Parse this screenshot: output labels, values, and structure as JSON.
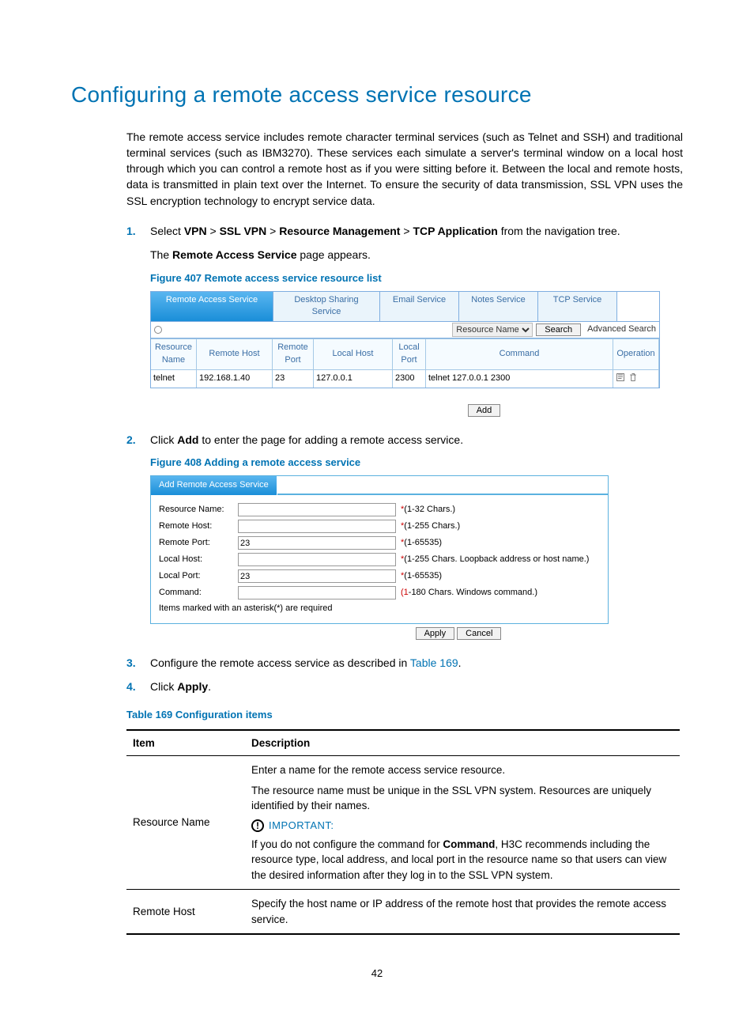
{
  "title": "Configuring a remote access service resource",
  "intro": "The remote access service includes remote character terminal services (such as Telnet and SSH) and traditional terminal services (such as IBM3270). These services each simulate a server's terminal window on a local host through which you can control a remote host as if you were sitting before it. Between the local and remote hosts, data is transmitted in plain text over the Internet. To ensure the security of data transmission, SSL VPN uses the SSL encryption technology to encrypt service data.",
  "step1_pre": "Select",
  "step1_nav": [
    "VPN",
    "SSL VPN",
    "Resource Management",
    "TCP Application"
  ],
  "step1_post": "from the navigation tree.",
  "step1_sub_pre": "The",
  "step1_sub_bold": "Remote Access Service",
  "step1_sub_post": "page appears.",
  "fig407_caption": "Figure 407 Remote access service resource list",
  "fig407": {
    "tabs": [
      "Remote Access Service",
      "Desktop Sharing Service",
      "Email Service",
      "Notes Service",
      "TCP Service"
    ],
    "search_select": "Resource Name",
    "search_button": "Search",
    "advanced": "Advanced Search",
    "headers": [
      "Resource Name",
      "Remote Host",
      "Remote Port",
      "Local Host",
      "Local Port",
      "Command",
      "Operation"
    ],
    "row": {
      "resource_name": "telnet",
      "remote_host": "192.168.1.40",
      "remote_port": "23",
      "local_host": "127.0.0.1",
      "local_port": "2300",
      "command": "telnet 127.0.0.1 2300"
    },
    "add_button": "Add"
  },
  "step2_pre": "Click",
  "step2_bold": "Add",
  "step2_post": "to enter the page for adding a remote access service.",
  "fig408_caption": "Figure 408 Adding a remote access service",
  "fig408": {
    "header": "Add Remote Access Service",
    "rows": [
      {
        "label": "Resource Name:",
        "value": "",
        "hint": "*(1-32 Chars.)"
      },
      {
        "label": "Remote Host:",
        "value": "",
        "hint": "*(1-255 Chars.)"
      },
      {
        "label": "Remote Port:",
        "value": "23",
        "hint": "*(1-65535)"
      },
      {
        "label": "Local Host:",
        "value": "",
        "hint": "*(1-255 Chars. Loopback address or host name.)"
      },
      {
        "label": "Local Port:",
        "value": "23",
        "hint": "*(1-65535)"
      },
      {
        "label": "Command:",
        "value": "",
        "hint": "(1-180 Chars. Windows command.)"
      }
    ],
    "note": "Items marked with an asterisk(*) are required",
    "apply": "Apply",
    "cancel": "Cancel"
  },
  "step3_pre": "Configure the remote access service as described in",
  "step3_link": "Table 169",
  "step3_post": ".",
  "step4_pre": "Click",
  "step4_bold": "Apply",
  "step4_post": ".",
  "t169_caption": "Table 169 Configuration items",
  "t169": {
    "headers": [
      "Item",
      "Description"
    ],
    "row1_item": "Resource Name",
    "row1_desc_p1": "Enter a name for the remote access service resource.",
    "row1_desc_p2": "The resource name must be unique in the SSL VPN system. Resources are uniquely identified by their names.",
    "row1_important": "IMPORTANT:",
    "row1_desc_p3_pre": "If you do not configure the command for",
    "row1_desc_p3_bold": "Command",
    "row1_desc_p3_post": ", H3C recommends including the resource type, local address, and local port in the resource name so that users can view the desired information after they log in to the SSL VPN system.",
    "row2_item": "Remote Host",
    "row2_desc": "Specify the host name or IP address of the remote host that provides the remote access service."
  },
  "page_number": "42"
}
